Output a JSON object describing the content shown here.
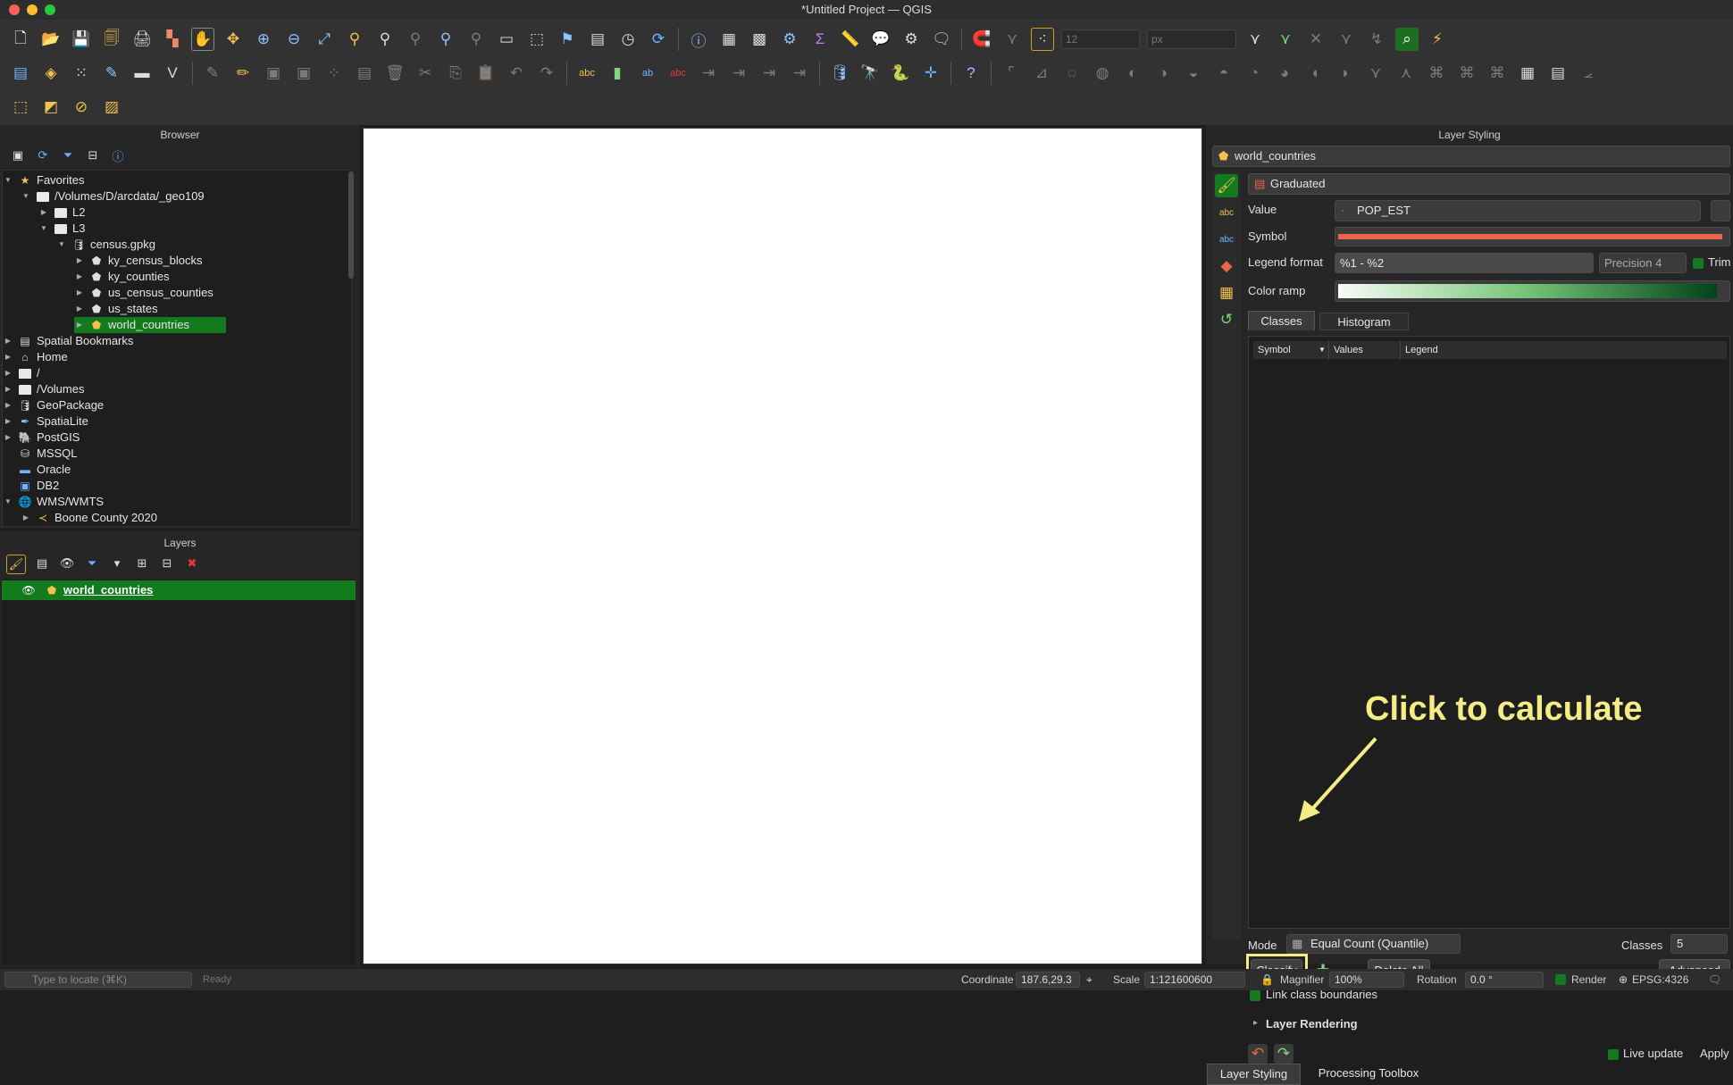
{
  "window": {
    "title": "*Untitled Project — QGIS"
  },
  "toolbar": {
    "row1_icons": [
      "new-project-icon",
      "open-project-icon",
      "save-project-icon",
      "save-as-icon",
      "print-layout-icon",
      "style-manager-icon",
      "pan-icon",
      "pan-to-selection-icon",
      "zoom-in-icon",
      "zoom-out-icon",
      "zoom-full-icon",
      "zoom-to-selection-icon",
      "zoom-to-layer-icon",
      "zoom-native-icon",
      "zoom-last-icon",
      "zoom-next-icon",
      "new-map-view-icon",
      "new-3d-view-icon",
      "new-bookmark-icon",
      "show-bookmarks-icon",
      "temporal-controller-icon",
      "refresh-icon",
      "identify-icon",
      "attribute-table-icon",
      "field-calculator-icon",
      "processing-toolbox-icon",
      "statistics-icon",
      "measure-icon",
      "map-tips-icon",
      "select-features-icon",
      "annotation-icon",
      "snapping-icon",
      "topology-icon",
      "tracing-icon"
    ],
    "tolerance_value": "12",
    "unit_value": "px"
  },
  "browser": {
    "title": "Browser",
    "items": [
      {
        "label": "Favorites",
        "level": 0,
        "expanded": true,
        "icon": "star-icon"
      },
      {
        "label": "/Volumes/D/arcdata/_geo109",
        "level": 1,
        "expanded": true,
        "icon": "folder-icon"
      },
      {
        "label": "L2",
        "level": 2,
        "expanded": false,
        "icon": "folder-icon"
      },
      {
        "label": "L3",
        "level": 2,
        "expanded": true,
        "icon": "folder-icon"
      },
      {
        "label": "census.gpkg",
        "level": 3,
        "expanded": true,
        "icon": "geopackage-icon"
      },
      {
        "label": "ky_census_blocks",
        "level": 4,
        "expanded": false,
        "icon": "polygon-layer-icon"
      },
      {
        "label": "ky_counties",
        "level": 4,
        "expanded": false,
        "icon": "polygon-layer-icon"
      },
      {
        "label": "us_census_counties",
        "level": 4,
        "expanded": false,
        "icon": "polygon-layer-icon"
      },
      {
        "label": "us_states",
        "level": 4,
        "expanded": false,
        "icon": "polygon-layer-icon"
      },
      {
        "label": "world_countries",
        "level": 4,
        "expanded": false,
        "icon": "polygon-layer-icon",
        "selected": true
      },
      {
        "label": "Spatial Bookmarks",
        "level": 0,
        "expanded": false,
        "icon": "bookmark-icon"
      },
      {
        "label": "Home",
        "level": 0,
        "expanded": false,
        "icon": "home-icon"
      },
      {
        "label": "/",
        "level": 0,
        "expanded": false,
        "icon": "folder-icon"
      },
      {
        "label": "/Volumes",
        "level": 0,
        "expanded": false,
        "icon": "folder-icon"
      },
      {
        "label": "GeoPackage",
        "level": 0,
        "expanded": false,
        "icon": "geopackage-icon"
      },
      {
        "label": "SpatiaLite",
        "level": 0,
        "expanded": false,
        "icon": "spatialite-icon"
      },
      {
        "label": "PostGIS",
        "level": 0,
        "expanded": false,
        "icon": "postgis-icon"
      },
      {
        "label": "MSSQL",
        "level": 0,
        "expanded": null,
        "icon": "mssql-icon"
      },
      {
        "label": "Oracle",
        "level": 0,
        "expanded": null,
        "icon": "oracle-icon"
      },
      {
        "label": "DB2",
        "level": 0,
        "expanded": null,
        "icon": "db2-icon"
      },
      {
        "label": "WMS/WMTS",
        "level": 0,
        "expanded": true,
        "icon": "wms-icon"
      },
      {
        "label": "Boone County 2020",
        "level": 1,
        "expanded": false,
        "icon": "wms-connection-icon"
      }
    ]
  },
  "layers": {
    "title": "Layers",
    "items": [
      {
        "label": "world_countries",
        "visible": true,
        "selected": true
      }
    ]
  },
  "styling": {
    "title": "Layer Styling",
    "layer": "world_countries",
    "renderer": "Graduated",
    "value_label": "Value",
    "value_field": "POP_EST",
    "symbol_label": "Symbol",
    "symbol_color": "#e8664a",
    "legend_format_label": "Legend format",
    "legend_format": "%1 - %2",
    "precision": "Precision 4",
    "trim_label": "Trim",
    "color_ramp_label": "Color ramp",
    "tabs": [
      "Classes",
      "Histogram"
    ],
    "columns": [
      "Symbol",
      "Values",
      "Legend"
    ],
    "mode_label": "Mode",
    "mode_value": "Equal Count (Quantile)",
    "classes_label": "Classes",
    "classes_value": "5",
    "classify_label": "Classify",
    "delete_all_label": "Delete All",
    "advanced_label": "Advanced",
    "link_boundaries_label": "Link class boundaries",
    "layer_rendering_label": "Layer Rendering",
    "live_update_label": "Live update",
    "apply_label": "Apply",
    "bottom_tabs": [
      "Layer Styling",
      "Processing Toolbox"
    ]
  },
  "annotation": {
    "text": "Click to calculate",
    "color": "#f5ec85"
  },
  "status": {
    "locator_placeholder": "Type to locate (⌘K)",
    "ready": "Ready",
    "coordinate_label": "Coordinate",
    "coordinate": "187.6,29.3",
    "scale_label": "Scale",
    "scale": "1:121600600",
    "magnifier_label": "Magnifier",
    "magnifier": "100%",
    "rotation_label": "Rotation",
    "rotation": "0.0 °",
    "render_label": "Render",
    "crs": "EPSG:4326"
  },
  "colors": {
    "accent": "#137a1e",
    "highlight": "#f5ec85"
  }
}
